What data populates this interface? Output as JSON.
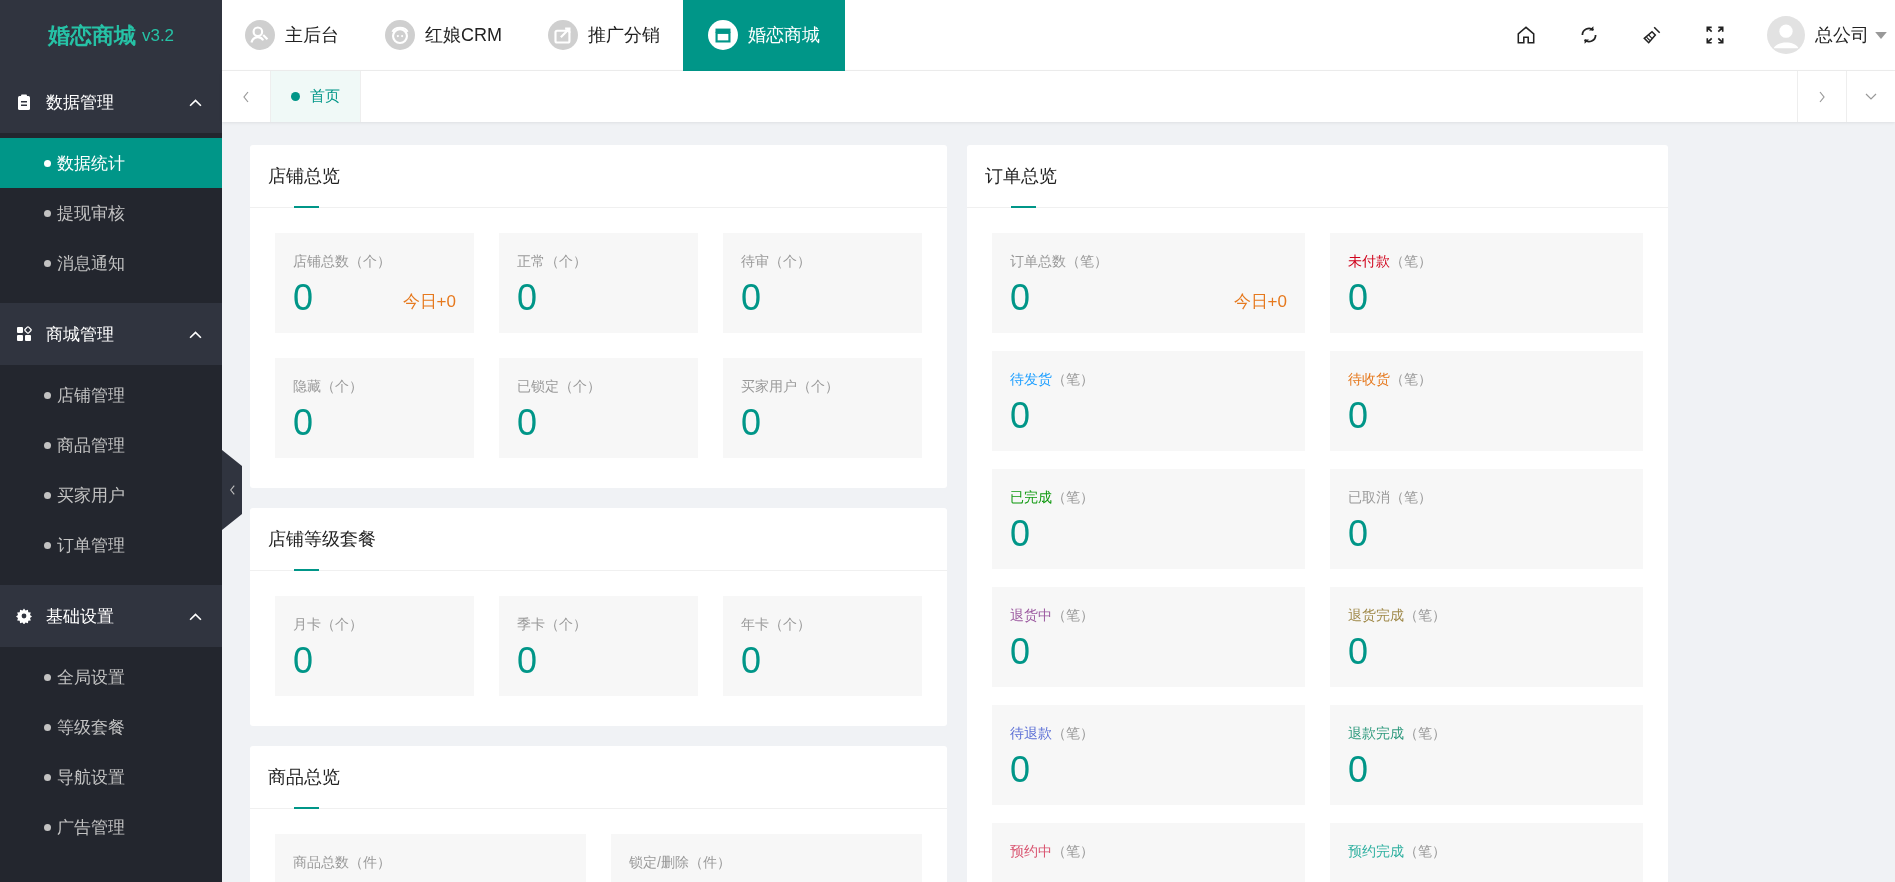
{
  "logo": {
    "name": "婚恋商城",
    "version": "v3.2"
  },
  "sidebar": {
    "groups": [
      {
        "title": "数据管理",
        "expanded": true,
        "items": [
          {
            "label": "数据统计",
            "selected": true
          },
          {
            "label": "提现审核",
            "selected": false
          },
          {
            "label": "消息通知",
            "selected": false
          }
        ]
      },
      {
        "title": "商城管理",
        "expanded": true,
        "items": [
          {
            "label": "店铺管理",
            "selected": false
          },
          {
            "label": "商品管理",
            "selected": false
          },
          {
            "label": "买家用户",
            "selected": false
          },
          {
            "label": "订单管理",
            "selected": false
          }
        ]
      },
      {
        "title": "基础设置",
        "expanded": true,
        "items": [
          {
            "label": "全局设置",
            "selected": false
          },
          {
            "label": "等级套餐",
            "selected": false
          },
          {
            "label": "导航设置",
            "selected": false
          },
          {
            "label": "广告管理",
            "selected": false
          }
        ]
      }
    ]
  },
  "top_nav": {
    "modules": [
      {
        "label": "主后台",
        "selected": false
      },
      {
        "label": "红娘CRM",
        "selected": false
      },
      {
        "label": "推广分销",
        "selected": false
      },
      {
        "label": "婚恋商城",
        "selected": true
      }
    ],
    "user": "总公司"
  },
  "tab_bar": {
    "tabs": [
      {
        "label": "首页",
        "selected": true
      }
    ]
  },
  "left_panels": [
    {
      "title": "店铺总览",
      "tiles": [
        {
          "label": "店铺总数",
          "unit": "（个）",
          "value": "0",
          "today": "今日+0"
        },
        {
          "label": "正常",
          "unit": "（个）",
          "value": "0"
        },
        {
          "label": "待审",
          "unit": "（个）",
          "value": "0"
        },
        {
          "label": "隐藏",
          "unit": "（个）",
          "value": "0"
        },
        {
          "label": "已锁定",
          "unit": "（个）",
          "value": "0"
        },
        {
          "label": "买家用户",
          "unit": "（个）",
          "value": "0"
        }
      ]
    },
    {
      "title": "店铺等级套餐",
      "tiles": [
        {
          "label": "月卡",
          "unit": "（个）",
          "value": "0"
        },
        {
          "label": "季卡",
          "unit": "（个）",
          "value": "0"
        },
        {
          "label": "年卡",
          "unit": "（个）",
          "value": "0"
        }
      ]
    },
    {
      "title": "商品总览",
      "tiles": [
        {
          "label": "商品总数",
          "unit": "（件）"
        },
        {
          "label": "锁定/删除",
          "unit": "（件）"
        }
      ]
    }
  ],
  "right_panels": [
    {
      "title": "订单总览",
      "tiles": [
        {
          "label": "订单总数",
          "unit": "（笔）",
          "value": "0",
          "today": "今日+0"
        },
        {
          "label": "未付款",
          "unit": "（笔）",
          "value": "0",
          "color": "#d0021b"
        },
        {
          "label": "待发货",
          "unit": "（笔）",
          "value": "0",
          "color": "#1e9fff"
        },
        {
          "label": "待收货",
          "unit": "（笔）",
          "value": "0",
          "color": "#e6791e"
        },
        {
          "label": "已完成",
          "unit": "（笔）",
          "value": "0",
          "color": "#119a11"
        },
        {
          "label": "已取消",
          "unit": "（笔）",
          "value": "0"
        },
        {
          "label": "退货中",
          "unit": "（笔）",
          "value": "0",
          "color": "#9c5aa0"
        },
        {
          "label": "退货完成",
          "unit": "（笔）",
          "value": "0",
          "color": "#a08a4a"
        },
        {
          "label": "待退款",
          "unit": "（笔）",
          "value": "0",
          "color": "#5b6fd6"
        },
        {
          "label": "退款完成",
          "unit": "（笔）",
          "value": "0",
          "color": "#2f9a7e"
        },
        {
          "label": "预约中",
          "unit": "（笔）",
          "color": "#d9536f"
        },
        {
          "label": "预约完成",
          "unit": "（笔）",
          "color": "#2fb0a0"
        }
      ]
    }
  ]
}
